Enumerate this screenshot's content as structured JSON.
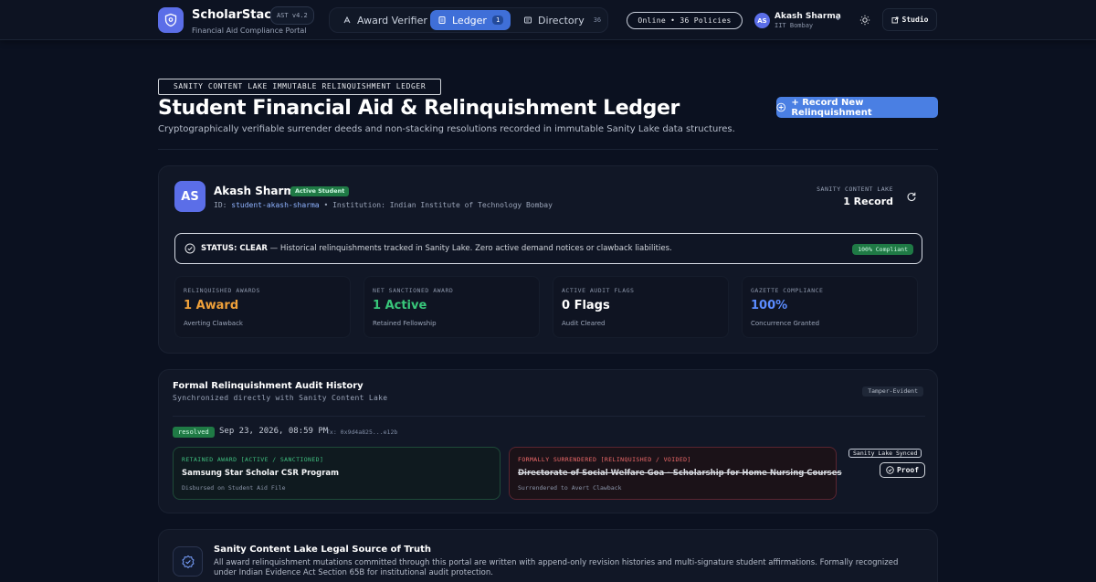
{
  "brand": {
    "name": "ScholarStack",
    "version": "AST v4.2",
    "subtitle": "Financial Aid Compliance Portal"
  },
  "nav": {
    "items": [
      {
        "label": "Award Verifier",
        "icon": "award-icon",
        "count": ""
      },
      {
        "label": "Ledger",
        "icon": "ledger-icon",
        "count": "1",
        "active": true
      },
      {
        "label": "Directory",
        "icon": "directory-icon",
        "count": "36"
      }
    ]
  },
  "status_pill": "Online • 36 Policies",
  "user": {
    "initials": "AS",
    "name": "Akash Sharma",
    "institution": "IIT Bombay"
  },
  "studio_label": "Studio",
  "header": {
    "overline": "SANITY CONTENT LAKE IMMUTABLE RELINQUISHMENT LEDGER",
    "title": "Student Financial Aid & Relinquishment Ledger",
    "subtitle": "Cryptographically verifiable surrender deeds and non-stacking resolutions recorded in immutable Sanity Lake data structures.",
    "record_button": "+ Record New Relinquishment"
  },
  "student": {
    "initials": "AS",
    "name": "Akash Sharma",
    "badge": "Active Student",
    "id_label": "ID:",
    "id_value": "student-akash-sharma",
    "separator": "•",
    "institution": "Institution: Indian Institute of Technology Bombay",
    "lake_label": "SANITY CONTENT LAKE",
    "lake_count": "1 Record"
  },
  "status_banner": {
    "strong": "STATUS: CLEAR",
    "text": " — Historical relinquishments tracked in Sanity Lake. Zero active demand notices or clawback liabilities.",
    "pill": "100% Compliant"
  },
  "stats": [
    {
      "label": "RELINQUISHED AWARDS",
      "value": "1 Award",
      "caption": "Averting Clawback",
      "color": "#f0a13a"
    },
    {
      "label": "NET SANCTIONED AWARD",
      "value": "1 Active",
      "caption": "Retained Fellowship",
      "color": "#38c77a"
    },
    {
      "label": "ACTIVE AUDIT FLAGS",
      "value": "0 Flags",
      "caption": "Audit Cleared",
      "color": "#ffffff"
    },
    {
      "label": "GAZETTE COMPLIANCE",
      "value": "100%",
      "caption": "Concurrence Granted",
      "color": "#5b8cff"
    }
  ],
  "history": {
    "title": "Formal Relinquishment Audit History",
    "subtitle": "Synchronized directly with Sanity Content Lake",
    "tamper": "Tamper-Evident",
    "entry": {
      "state": "resolved",
      "date": "Sep 23, 2026, 08:59 PM",
      "tx": "Tx: 0x9d4a825...e12b",
      "retained": {
        "tag": "RETAINED AWARD [ACTIVE / SANCTIONED]",
        "name": "Samsung Star Scholar CSR Program",
        "note": "Disbursed on Student Aid File"
      },
      "voided": {
        "tag": "FORMALLY SURRENDERED [RELINQUISHED / VOIDED]",
        "name": "Directorate of Social Welfare Goa - Scholarship for Home Nursing Courses",
        "note": "Surrendered to Avert Clawback"
      },
      "synced": "Sanity Lake Synced",
      "proof": "Proof"
    }
  },
  "legal": {
    "title": "Sanity Content Lake Legal Source of Truth",
    "text": "All award relinquishment mutations committed through this portal are written with append-only revision histories and multi-signature student affirmations. Formally recognized under Indian Evidence Act Section 65B for institutional audit protection."
  },
  "colors": {
    "accent": "#4a7fe3",
    "success": "#1f7a45",
    "warning": "#f0a13a",
    "danger": "#5a2530"
  }
}
